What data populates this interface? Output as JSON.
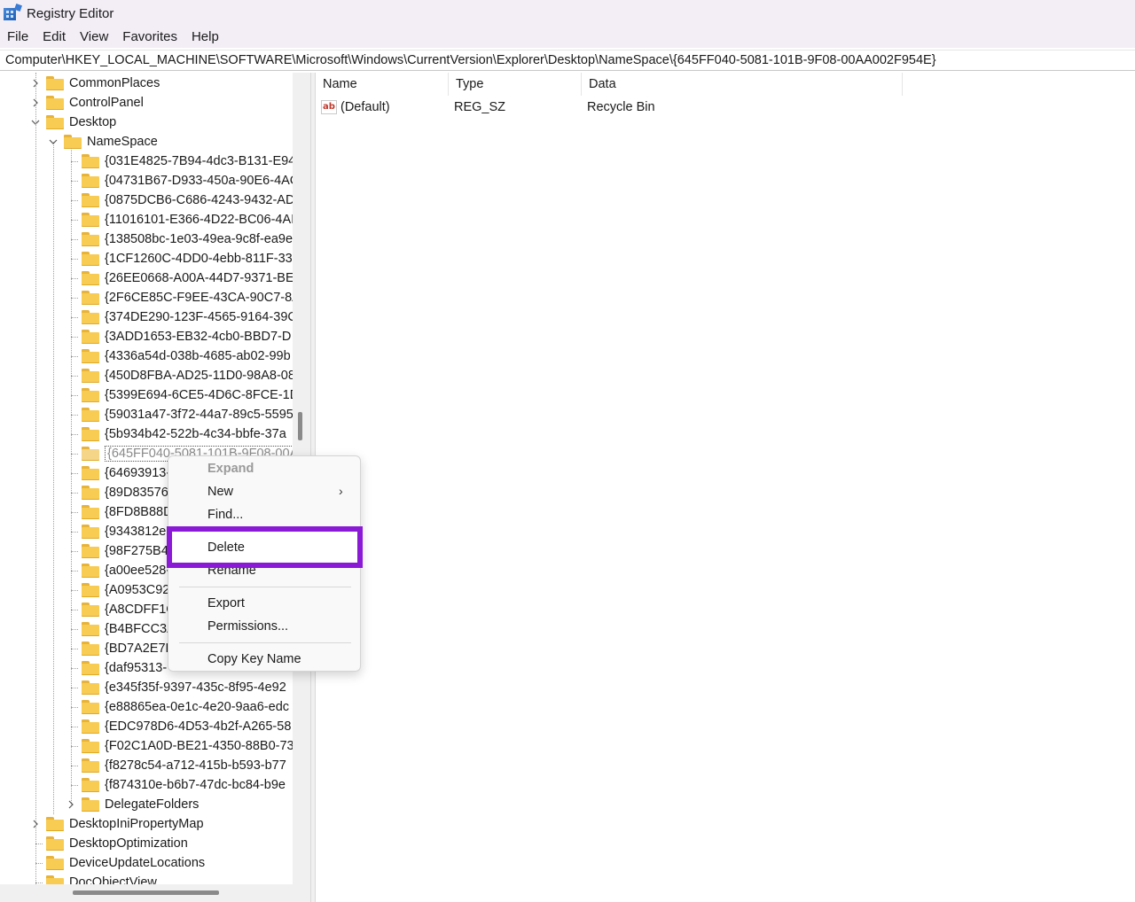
{
  "window": {
    "title": "Registry Editor"
  },
  "menu": [
    "File",
    "Edit",
    "View",
    "Favorites",
    "Help"
  ],
  "address": {
    "path": "Computer\\HKEY_LOCAL_MACHINE\\SOFTWARE\\Microsoft\\Windows\\CurrentVersion\\Explorer\\Desktop\\NameSpace\\{645FF040-5081-101B-9F08-00AA002F954E}"
  },
  "tree": {
    "top": [
      {
        "label": "CommonPlaces",
        "expander": "collapsed"
      },
      {
        "label": "ControlPanel",
        "expander": "collapsed"
      },
      {
        "label": "Desktop",
        "expander": "expanded"
      }
    ],
    "namespace": {
      "label": "NameSpace",
      "expander": "expanded"
    },
    "keys": [
      "{031E4825-7B94-4dc3-B131-E94",
      "{04731B67-D933-450a-90E6-4AC",
      "{0875DCB6-C686-4243-9432-AD",
      "{11016101-E366-4D22-BC06-4AI",
      "{138508bc-1e03-49ea-9c8f-ea9e",
      "{1CF1260C-4DD0-4ebb-811F-33",
      "{26EE0668-A00A-44D7-9371-BE",
      "{2F6CE85C-F9EE-43CA-90C7-8A",
      "{374DE290-123F-4565-9164-39C",
      "{3ADD1653-EB32-4cb0-BBD7-D",
      "{4336a54d-038b-4685-ab02-99b",
      "{450D8FBA-AD25-11D0-98A8-08",
      "{5399E694-6CE5-4D6C-8FCE-1D",
      "{59031a47-3f72-44a7-89c5-5595",
      "{5b934b42-522b-4c34-bbfe-37a",
      "{645FF040-5081-101B-9F08-00AA002F954E}",
      "{64693913-",
      "{89D83576-",
      "{8FD8B88D",
      "{9343812e-",
      "{98F275B4-",
      "{a00ee528-",
      "{A0953C92-",
      "{A8CDFF1C",
      "{B4BFCC3A",
      "{BD7A2E7B",
      "{daf95313-",
      "{e345f35f-9397-435c-8f95-4e92",
      "{e88865ea-0e1c-4e20-9aa6-edc",
      "{EDC978D6-4D53-4b2f-A265-58",
      "{F02C1A0D-BE21-4350-88B0-73",
      "{f8278c54-a712-415b-b593-b77",
      "{f874310e-b6b7-47dc-bc84-b9e"
    ],
    "selected_index": 15,
    "delegate": {
      "label": "DelegateFolders",
      "expander": "collapsed"
    },
    "bottom": [
      {
        "label": "DesktopIniPropertyMap",
        "expander": "collapsed"
      },
      {
        "label": "DesktopOptimization",
        "expander": "none"
      },
      {
        "label": "DeviceUpdateLocations",
        "expander": "none"
      },
      {
        "label": "DocObjectView",
        "expander": "none"
      }
    ]
  },
  "list": {
    "columns": [
      "Name",
      "Type",
      "Data"
    ],
    "rows": [
      {
        "icon": "string-value-icon",
        "icon_text": "ab",
        "name": "(Default)",
        "type": "REG_SZ",
        "data": "Recycle Bin"
      }
    ]
  },
  "context_menu": {
    "expand": "Expand",
    "new": "New",
    "new_arrow": "›",
    "find": "Find...",
    "delete": "Delete",
    "rename": "Rename",
    "export": "Export",
    "permissions": "Permissions...",
    "copy_key_name": "Copy Key Name"
  },
  "colors": {
    "highlight": "#8a1ad6",
    "folder": "#f8cc52",
    "titlebar": "#f3eef6"
  }
}
